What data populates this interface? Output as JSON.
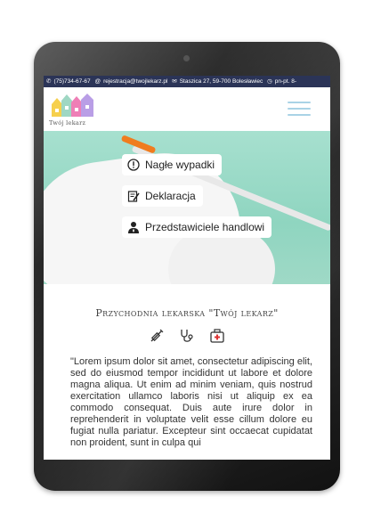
{
  "contact": {
    "phone": "(75)734-67-67",
    "email": "rejestracja@twojlekarz.pl",
    "address": "Staszica 27, 59-700 Bolesławiec",
    "hours": "pn-pt. 8-"
  },
  "brand": {
    "logo_text": "Twój lekarz"
  },
  "hero": {
    "buttons": [
      {
        "label": "Nagłe wypadki",
        "icon": "exclamation-circle-icon"
      },
      {
        "label": "Deklaracja",
        "icon": "form-edit-icon"
      },
      {
        "label": "Przedstawiciele handlowi",
        "icon": "user-tie-icon"
      }
    ]
  },
  "section": {
    "title": "Przychodnia lekarska \"Twój lekarz\"",
    "icons": [
      "syringe-icon",
      "stethoscope-icon",
      "medical-kit-icon"
    ],
    "paragraph": "\"Lorem ipsum dolor sit amet, consectetur adipiscing elit, sed do eiusmod tempor incididunt ut labore et dolore magna aliqua. Ut enim ad minim veniam, quis nostrud exercitation ullamco laboris nisi ut aliquip ex ea commodo consequat. Duis aute irure dolor in reprehenderit in voluptate velit esse cillum dolore eu fugiat nulla pariatur. Excepteur sint occaecat cupidatat non proident, sunt in culpa qui"
  },
  "colors": {
    "topbar": "#2b3457",
    "hamburger": "#a9d3e6",
    "hero": "#8fd5c0"
  }
}
